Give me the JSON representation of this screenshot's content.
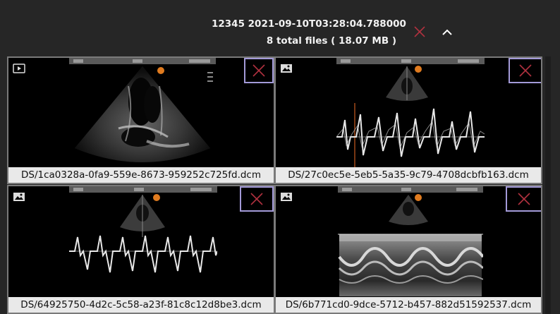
{
  "header": {
    "study_line": "12345 2021-09-10T03:28:04.788000",
    "files_line": "8 total files ( 18.07 MB )",
    "close_icon": "x-icon",
    "collapse_icon": "chevron-up-icon",
    "close_color": "#b0313f"
  },
  "cards": [
    {
      "filename": "DS/1ca0328a-0fa9-559e-8673-959252c725fd.dcm",
      "type_icon": "video-icon",
      "view": "echo-sector"
    },
    {
      "filename": "DS/27c0ec5e-5eb5-5a35-9c79-4708dcbfb163.dcm",
      "type_icon": "image-icon",
      "view": "doppler"
    },
    {
      "filename": "DS/64925750-4d2c-5c58-a23f-81c8c12d8be3.dcm",
      "type_icon": "image-icon",
      "view": "doppler"
    },
    {
      "filename": "DS/6b771cd0-9dce-5712-b457-882d51592537.dcm",
      "type_icon": "image-icon",
      "view": "m-mode"
    }
  ],
  "colors": {
    "remove_border": "#a39ad8",
    "remove_x": "#b0313f",
    "filename_bg": "#e9e9e9"
  }
}
